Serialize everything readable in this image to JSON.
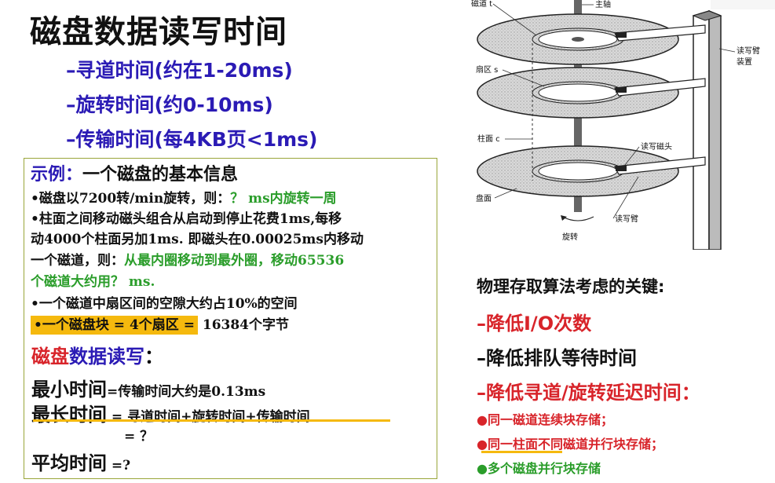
{
  "title": "磁盘数据读写时间",
  "times": [
    "–寻道时间(约在1-20ms)",
    "–旋转时间(约0-10ms)",
    "–传输时间(每4KB页<1ms)"
  ],
  "example": {
    "title_prefix": "示例：",
    "title_rest": "一个磁盘的基本信息",
    "line1_a": "•磁盘以7200转/min旋转，则：",
    "line1_b": "？ ms内旋转一周",
    "line2": "•柱面之间移动磁头组合从启动到停止花费1ms,每移",
    "line3": "动4000个柱面另加1ms. 即磁头在0.00025ms内移动",
    "line4_a": "一个磁道，则：",
    "line4_b": "从最内圈移动到最外圈，移动65536",
    "line5": "个磁道大约用？ ms.",
    "line6": "•一个磁道中扇区间的空隙大约占10%的空间",
    "line7_a": "•一个磁盘块 = 4个扇区 =",
    "line7_b": " 16384个字节"
  },
  "rw": {
    "title_red": "磁盘",
    "title_blue": "数据读写",
    "colon": "：",
    "min_label": "最小时间",
    "min_text": "=传输时间大约是0.13ms",
    "max_label": "最长时间",
    "max_text": " = 寻道时间+旋转时间+传输时间",
    "max_eq": "= ？",
    "avg_label": "平均时间",
    "avg_eq": " =",
    "avg_q": "?"
  },
  "diagram": {
    "labels": {
      "track": "磁道 t",
      "spindle": "主轴",
      "sector": "扇区 s",
      "arm_assembly_1": "读写臂",
      "arm_assembly_2": "装置",
      "cylinder": "柱面 c",
      "head": "读写磁头",
      "platter": "盘面",
      "arm": "读写臂",
      "rotation": "旋转"
    }
  },
  "right": {
    "heading": "物理存取算法考虑的关键:",
    "items": [
      {
        "text": "–降低I/O次数",
        "color": "#d8242a"
      },
      {
        "text": "–降低排队等待时间",
        "color": "#111111"
      },
      {
        "text": "–降低寻道/旋转延迟时间：",
        "color": "#d8242a"
      }
    ],
    "bullets": [
      {
        "text": "●同一磁道连续块存储；",
        "color": "#d8242a"
      },
      {
        "text": "●同一柱面不同磁道并行块存储；",
        "color": "#d8242a"
      },
      {
        "text": "●多个磁盘并行块存储",
        "color": "#2a9d2a"
      }
    ]
  },
  "colors": {
    "blue": "#2b1bb5",
    "red": "#d8242a",
    "green": "#2a9d2a",
    "highlight": "#f5b90e"
  }
}
